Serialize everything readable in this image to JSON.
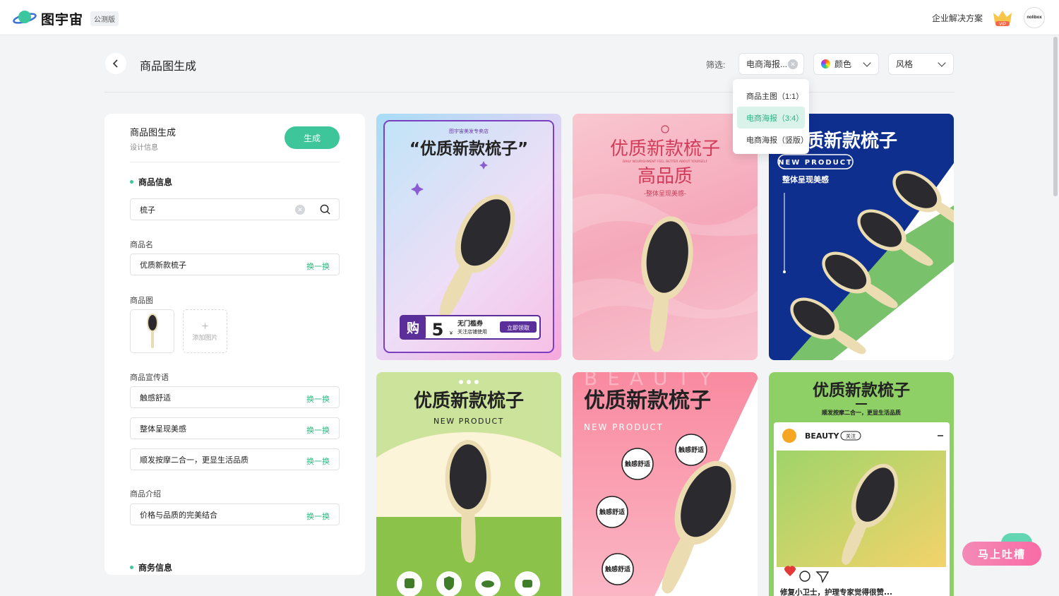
{
  "header": {
    "brand": "图宇宙",
    "beta_badge": "公测版",
    "enterprise_link": "企业解决方案",
    "vip_badge": "VIP",
    "avatar_text": "nolibox"
  },
  "page": {
    "title": "商品图生成",
    "filter_label": "筛选:",
    "filter_type": "电商海报...",
    "filter_color": "颜色",
    "filter_style": "风格",
    "dropdown_options": [
      "商品主图（1:1）",
      "电商海报（3:4）",
      "电商海报（竖版）"
    ],
    "dropdown_selected_index": 1
  },
  "panel": {
    "title": "商品图生成",
    "subtitle": "设计信息",
    "generate_label": "生成",
    "section_product": "商品信息",
    "search_value": "梳子",
    "name_label": "商品名",
    "name_value": "优质新款梳子",
    "swap_label": "换一换",
    "image_label": "商品图",
    "add_image": "添加图片",
    "slogan_label": "商品宣传语",
    "slogans": [
      "触感舒适",
      "整体呈现美感",
      "顺发按摩二合一，更显生活品质"
    ],
    "intro_label": "商品介绍",
    "intro_value": "价格与品质的完美结合",
    "section_business": "商务信息"
  },
  "cards": {
    "c1": {
      "shop": "图宇宙美发专卖店",
      "headline": "“优质新款梳子”",
      "buy": "购",
      "amount": "5",
      "currency": "¥",
      "coupon_title": "无门槛券",
      "coupon_sub": "关注店铺使用",
      "claim": "立即领取"
    },
    "c2": {
      "line1": "优质新款梳子",
      "tiny": "DAILY NOURISHMENT FEEL BETTER ABOUT YOURSELF",
      "line2": "高品质",
      "sub": "-整体呈现美感-"
    },
    "c3": {
      "headline": "质新款梳子",
      "badge": "NEW PRODUCT",
      "sub": "整体呈现美感"
    },
    "c4": {
      "headline": "优质新款梳子",
      "sub": "NEW PRODUCT"
    },
    "c5": {
      "bg_text": "BEAUTY",
      "headline": "优质新款梳子",
      "sub": "NEW PRODUCT",
      "tag": "触感舒适"
    },
    "c6": {
      "headline": "优质新款梳子",
      "sub": "顺发按摩二合一，更显生活品质",
      "account": "BEAUTY",
      "follow": "关注",
      "caption": "修复小卫士，护理专家觉得很赞..."
    }
  },
  "feedback_button": "马上吐槽",
  "colors": {
    "accent": "#3fc59a",
    "dropdown_active_bg": "#d9f3ea"
  }
}
